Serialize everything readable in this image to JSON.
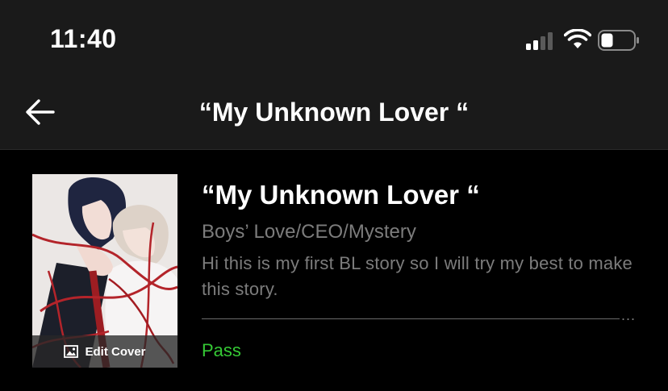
{
  "status_bar": {
    "time": "11:40",
    "icons": [
      "signal-icon",
      "wifi-icon",
      "battery-icon"
    ]
  },
  "nav": {
    "title": "“My Unknown Lover “",
    "back_icon": "arrow-left-icon"
  },
  "story": {
    "title": "“My Unknown Lover “",
    "genre": "Boys’ Love/CEO/Mystery",
    "description": "Hi this is my first BL story so I will try my best to make this story.",
    "more_label": "...",
    "status": "Pass",
    "cover": {
      "edit_label": "Edit Cover",
      "edit_icon": "image-icon"
    }
  },
  "colors": {
    "background": "#000000",
    "bar_background": "#1a1a1a",
    "secondary_text": "#7c7c7c",
    "status_pass": "#35c935"
  }
}
